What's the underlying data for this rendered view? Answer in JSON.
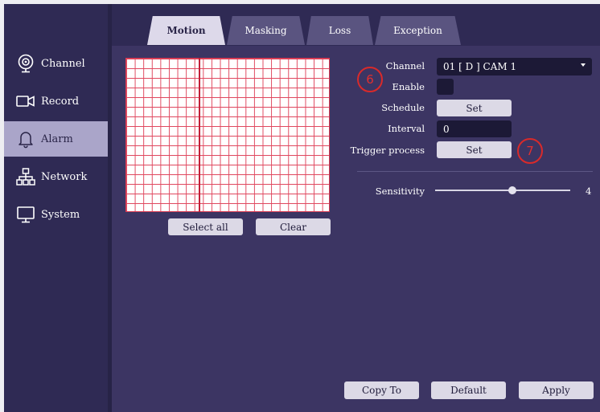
{
  "sidebar": {
    "items": [
      {
        "label": "Channel",
        "icon": "webcam-icon"
      },
      {
        "label": "Record",
        "icon": "video-camera-icon"
      },
      {
        "label": "Alarm",
        "icon": "bell-icon"
      },
      {
        "label": "Network",
        "icon": "network-icon"
      },
      {
        "label": "System",
        "icon": "monitor-icon"
      }
    ],
    "active": "Alarm"
  },
  "tabs": [
    {
      "label": "Motion"
    },
    {
      "label": "Masking"
    },
    {
      "label": "Loss"
    },
    {
      "label": "Exception"
    }
  ],
  "active_tab": "Motion",
  "grid_buttons": {
    "select_all": "Select all",
    "clear": "Clear"
  },
  "form": {
    "channel_label": "Channel",
    "channel_value": "01 [ D ] CAM 1",
    "enable_label": "Enable",
    "schedule_label": "Schedule",
    "schedule_button": "Set",
    "interval_label": "Interval",
    "interval_value": "0",
    "trigger_label": "Trigger process",
    "trigger_button": "Set",
    "sensitivity_label": "Sensitivity",
    "sensitivity_value": "4",
    "sensitivity_fraction": 0.57
  },
  "annotations": {
    "callout_1": "6",
    "callout_2": "7"
  },
  "footer": {
    "copy_to": "Copy To",
    "default": "Default",
    "apply": "Apply"
  },
  "colors": {
    "background": "#3c3563",
    "sidebar": "#2f2a54",
    "active_item": "#aaa5c9",
    "grid_line": "#e0485f",
    "annotation": "#d92a2a"
  }
}
